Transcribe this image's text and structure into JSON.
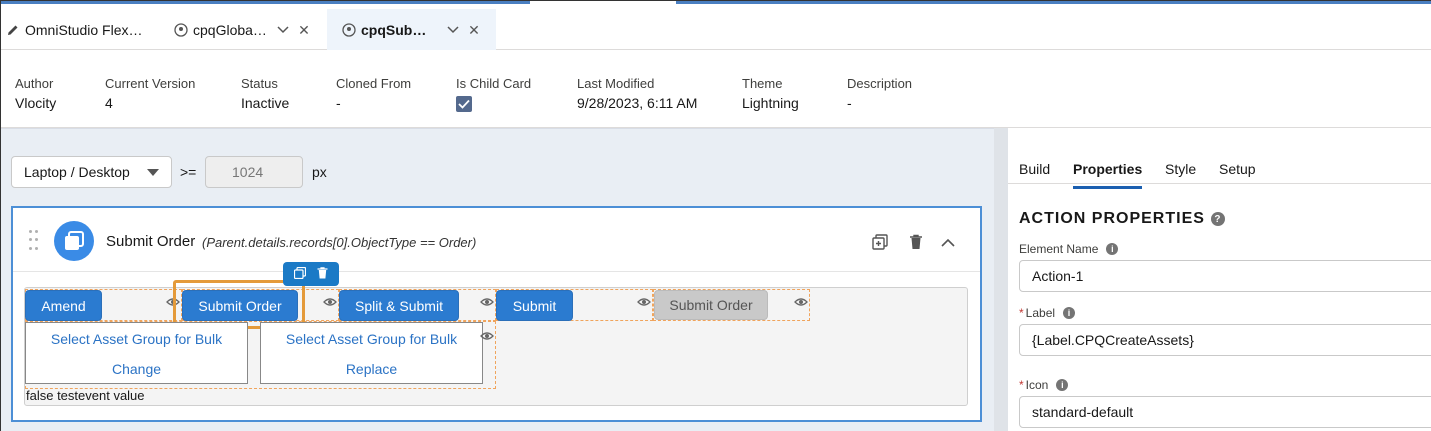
{
  "tabs": [
    {
      "label": "OmniStudio Flex…",
      "icon": "pencil-icon",
      "active": false
    },
    {
      "label": "cpqGloba…",
      "icon": "flexcard-icon",
      "active": false
    },
    {
      "label": "cpqSub…",
      "icon": "flexcard-icon",
      "active": true
    }
  ],
  "header": {
    "fields": [
      {
        "label": "Author",
        "value": "Vlocity"
      },
      {
        "label": "Current Version",
        "value": "4"
      },
      {
        "label": "Status",
        "value": "Inactive"
      },
      {
        "label": "Cloned From",
        "value": "-"
      },
      {
        "label": "Is Child Card",
        "value": ""
      },
      {
        "label": "Last Modified",
        "value": "9/28/2023, 6:11 AM"
      },
      {
        "label": "Theme",
        "value": "Lightning"
      },
      {
        "label": "Description",
        "value": "-"
      }
    ]
  },
  "toolbar": {
    "device": "Laptop / Desktop",
    "operator": ">=",
    "width_placeholder": "1024",
    "unit": "px"
  },
  "card": {
    "title": "Submit Order",
    "condition": "(Parent.details.records[0].ObjectType == Order)",
    "buttons": {
      "amend": "Amend",
      "submit_order": "Submit Order",
      "split_submit": "Split & Submit",
      "submit": "Submit",
      "submit_order_disabled": "Submit Order"
    },
    "bulk": [
      {
        "line1": "Select Asset Group for Bulk",
        "line2": "Change"
      },
      {
        "line1": "Select Asset Group for Bulk",
        "line2": "Replace"
      }
    ],
    "footer_text": "false testevent value"
  },
  "panel": {
    "tabs": [
      "Build",
      "Properties",
      "Style",
      "Setup"
    ],
    "active_tab": "Properties",
    "title": "ACTION PROPERTIES",
    "element_name_label": "Element Name",
    "element_name_value": "Action-1",
    "label_label": "Label",
    "label_value": "{Label.CPQCreateAssets}",
    "icon_label": "Icon",
    "icon_value": "standard-default",
    "required_mark": "*"
  },
  "colors": {
    "brand": "#2b7bd0",
    "highlight": "#e49a3a",
    "active_tab_bg": "#eef4fb"
  }
}
